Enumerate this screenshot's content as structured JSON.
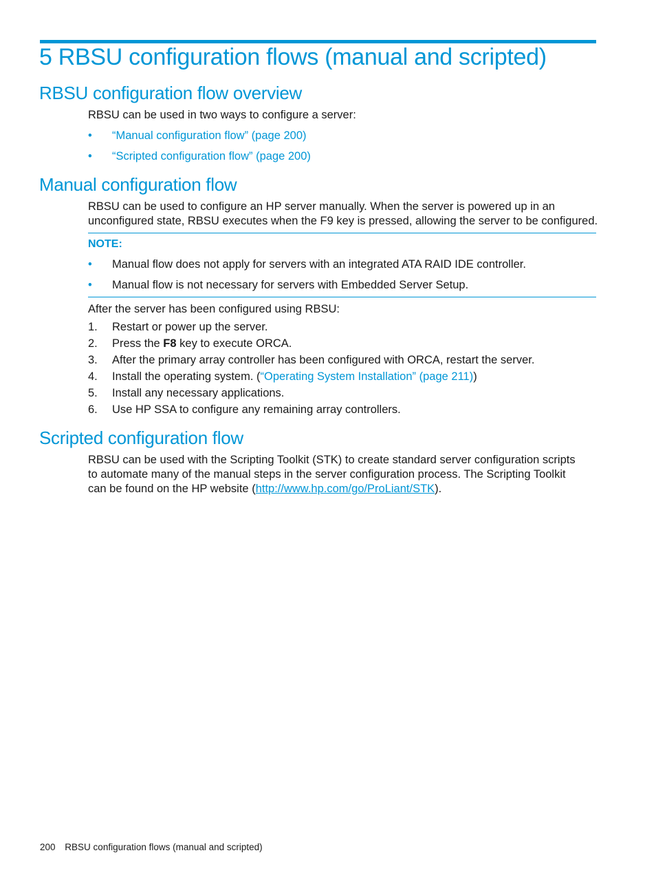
{
  "chapter": {
    "title": "5 RBSU configuration flows (manual and scripted)"
  },
  "overview": {
    "heading": "RBSU configuration flow overview",
    "intro": "RBSU can be used in two ways to configure a server:",
    "links": [
      {
        "label": "“Manual configuration flow” (page 200)"
      },
      {
        "label": "“Scripted configuration flow” (page 200)"
      }
    ]
  },
  "manual": {
    "heading": "Manual configuration flow",
    "para_line1": "RBSU can be used to configure an HP server manually. When the server is powered up in an",
    "para_line2": "unconfigured state, RBSU executes when the F9 key is pressed, allowing the server to be configured.",
    "note": {
      "label": "NOTE:",
      "items": [
        "Manual flow does not apply for servers with an integrated ATA RAID IDE controller.",
        "Manual flow is not necessary for servers with Embedded Server Setup."
      ]
    },
    "after_intro": "After the server has been configured using RBSU:",
    "steps": [
      {
        "num": "1.",
        "text": "Restart or power up the server."
      },
      {
        "num": "2.",
        "pre": "Press the ",
        "bold": "F8",
        "post": " key to execute ORCA."
      },
      {
        "num": "3.",
        "text": "After the primary array controller has been configured with ORCA, restart the server."
      },
      {
        "num": "4.",
        "pre": "Install the operating system. (",
        "link": "“Operating System Installation” (page 211)",
        "post": ")"
      },
      {
        "num": "5.",
        "text": "Install any necessary applications."
      },
      {
        "num": "6.",
        "text": "Use HP SSA to configure any remaining array controllers."
      }
    ]
  },
  "scripted": {
    "heading": "Scripted configuration flow",
    "line1": "RBSU can be used with the Scripting Toolkit (STK) to create standard server configuration scripts",
    "line2": "to automate many of the manual steps in the server configuration process. The Scripting Toolkit",
    "line3_pre": "can be found on the HP website (",
    "line3_link": "http://www.hp.com/go/ProLiant/STK",
    "line3_post": ")."
  },
  "footer": {
    "page_number": "200",
    "chapter_title": "RBSU configuration flows (manual and scripted)"
  },
  "colors": {
    "accent": "#0096d6",
    "text": "#1a1a1a"
  }
}
